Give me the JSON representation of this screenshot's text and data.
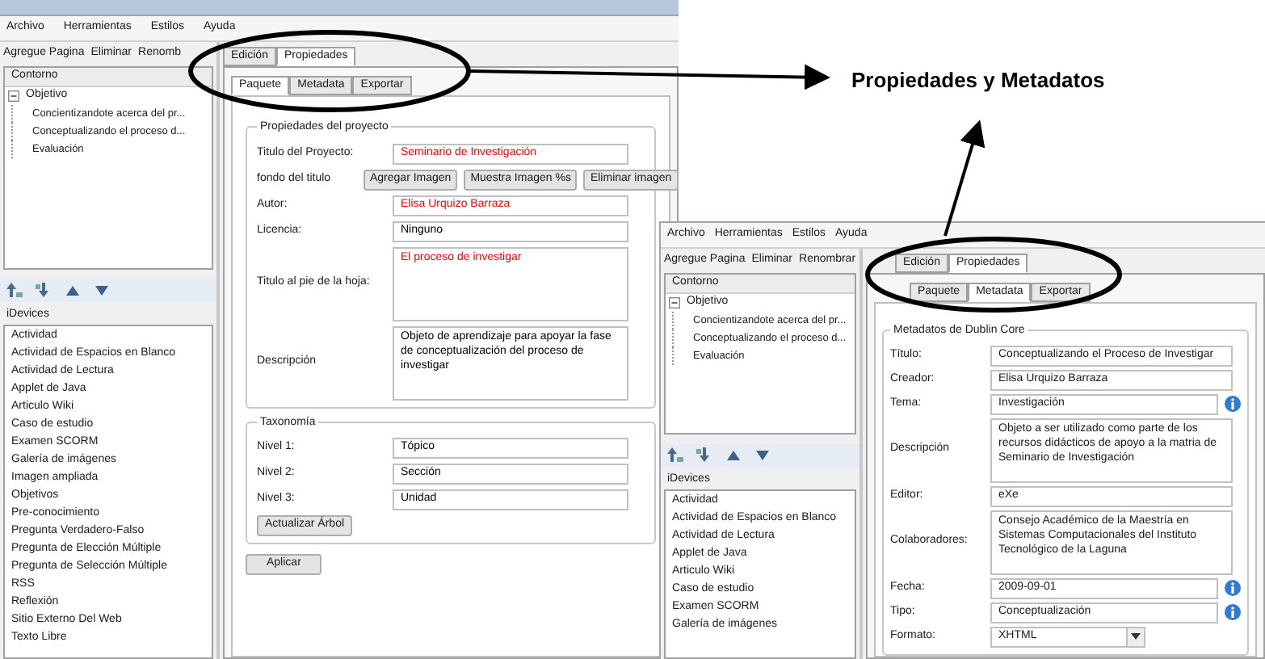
{
  "windows": [
    {
      "menu": [
        "Archivo",
        "Herramientas",
        "Estilos",
        "Ayuda"
      ],
      "toolbar": [
        "Agregue Pagina",
        "Eliminar",
        "Renomb"
      ],
      "outline": {
        "title": "Contorno",
        "tree": [
          {
            "label": "Objetivo",
            "expanded": true,
            "children": [
              {
                "label": "Concientizandote acerca del pr..."
              },
              {
                "label": "Conceptualizando el proceso d..."
              },
              {
                "label": "Evaluación"
              }
            ]
          }
        ]
      },
      "idevices": {
        "title": "iDevices",
        "items": [
          "Actividad",
          "Actividad de Espacios en Blanco",
          "Actividad de Lectura",
          "Applet de Java",
          "Articulo Wiki",
          "Caso de estudio",
          "Examen SCORM",
          "Galería de imágenes",
          "Imagen ampliada",
          "Objetivos",
          "Pre-conocimiento",
          "Pregunta Verdadero-Falso",
          "Pregunta de Elección Múltiple",
          "Pregunta de Selección Múltiple",
          "RSS",
          "Reflexión",
          "Sitio Externo Del Web",
          "Texto Libre"
        ]
      },
      "tabs": [
        {
          "label": "Edición",
          "selected": false
        },
        {
          "label": "Propiedades",
          "selected": true
        }
      ],
      "subtabs": [
        {
          "label": "Paquete",
          "selected": true
        },
        {
          "label": "Metadata",
          "selected": false
        },
        {
          "label": "Exportar",
          "selected": false
        }
      ],
      "fieldsets": [
        {
          "title": "Propiedades del proyecto",
          "fields": [
            {
              "kind": "text",
              "label": "Titulo del Proyecto:",
              "value": "Seminario de Investigación",
              "color": "#ff0000"
            },
            {
              "kind": "buttons",
              "label": "fondo del titulo",
              "buttons": [
                "Agregar Imagen",
                "Muestra Imagen %s",
                "Eliminar imagen"
              ]
            },
            {
              "kind": "text",
              "label": "Autor:",
              "value": "Elisa Urquizo Barraza",
              "color": "#ff0000"
            },
            {
              "kind": "text",
              "label": "Licencia:",
              "value": "Ninguno",
              "color": "#000000"
            },
            {
              "kind": "textarea",
              "label": "Titulo al pie de la hoja:",
              "value": "El proceso de investigar",
              "color": "#ff0000"
            },
            {
              "kind": "textarea",
              "label": "Descripción",
              "value": "Objeto de aprendizaje para apoyar la fase de conceptualización del proceso de investigar",
              "color": "#000000"
            }
          ]
        },
        {
          "title": "Taxonomía",
          "fields": [
            {
              "kind": "text",
              "label": "Nivel 1:",
              "value": "Tópico",
              "color": "#000000"
            },
            {
              "kind": "text",
              "label": "Nivel 2:",
              "value": "Sección",
              "color": "#000000"
            },
            {
              "kind": "text",
              "label": "Nivel 3:",
              "value": "Unidad",
              "color": "#000000"
            },
            {
              "kind": "button",
              "label": "Actualizar Árbol"
            }
          ]
        }
      ],
      "apply": "Aplicar"
    },
    {
      "menu": [
        "Archivo",
        "Herramientas",
        "Estilos",
        "Ayuda"
      ],
      "toolbar": [
        "Agregue Pagina",
        "Eliminar",
        "Renombrar"
      ],
      "outline": {
        "title": "Contorno",
        "tree": [
          {
            "label": "Objetivo",
            "expanded": true,
            "children": [
              {
                "label": "Concientizandote acerca del pr..."
              },
              {
                "label": "Conceptualizando el proceso d..."
              },
              {
                "label": "Evaluación"
              }
            ]
          }
        ]
      },
      "idevices": {
        "title": "iDevices",
        "items": [
          "Actividad",
          "Actividad de Espacios en Blanco",
          "Actividad de Lectura",
          "Applet de Java",
          "Articulo Wiki",
          "Caso de estudio",
          "Examen SCORM",
          "Galería de imágenes"
        ]
      },
      "tabs": [
        {
          "label": "Edición",
          "selected": false
        },
        {
          "label": "Propiedades",
          "selected": true
        }
      ],
      "subtabs": [
        {
          "label": "Paquete",
          "selected": false
        },
        {
          "label": "Metadata",
          "selected": true
        },
        {
          "label": "Exportar",
          "selected": false
        }
      ],
      "fieldsets": [
        {
          "title": "Metadatos de Dublin Core",
          "fields": [
            {
              "kind": "text",
              "label": "Título:",
              "value": "Conceptualizando el Proceso de Investigar",
              "info": false
            },
            {
              "kind": "text",
              "label": "Creador:",
              "value": "Elisa Urquizo Barraza",
              "info": false
            },
            {
              "kind": "text",
              "label": "Tema:",
              "value": "Investigación",
              "info": true
            },
            {
              "kind": "textarea",
              "label": "Descripción",
              "value": "Objeto a ser utilizado como parte de los recursos didácticos de apoyo a la matria de Seminario de Investigación",
              "info": false
            },
            {
              "kind": "text",
              "label": "Editor:",
              "value": "eXe",
              "info": false
            },
            {
              "kind": "textarea",
              "label": "Colaboradores:",
              "value": "Consejo Académico de la Maestría en Sistemas Computacionales del Instituto Tecnológico de la Laguna",
              "info": false
            },
            {
              "kind": "text",
              "label": "Fecha:",
              "value": "2009-09-01",
              "info": true
            },
            {
              "kind": "text",
              "label": "Tipo:",
              "value": "Conceptualización",
              "info": true
            },
            {
              "kind": "select",
              "label": "Formato:",
              "value": "XHTML",
              "info": false
            }
          ]
        }
      ]
    }
  ],
  "annotation": {
    "label": "Propiedades y Metadatos"
  }
}
